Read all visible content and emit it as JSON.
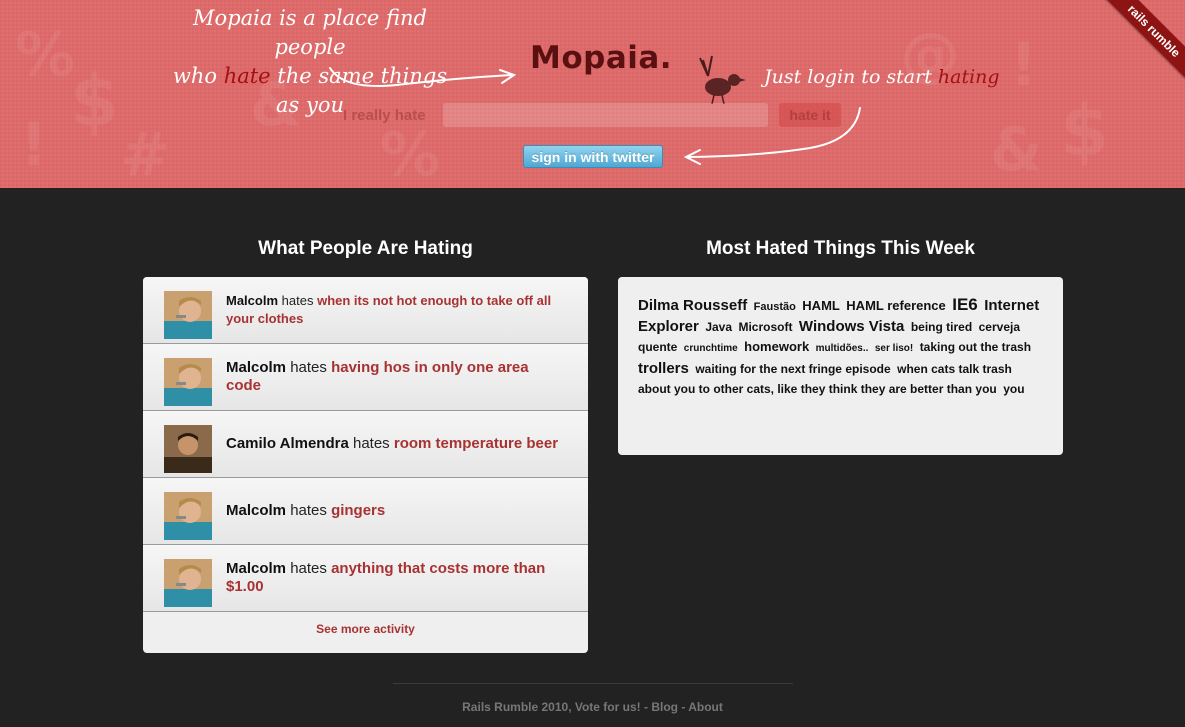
{
  "header": {
    "tagline_line1": "Mopaia is a place find people",
    "tagline_pre": "who ",
    "tagline_highlight": "hate",
    "tagline_post": " the same things as you",
    "logo": "Mopaia.",
    "login_hint_pre": "Just login to start ",
    "login_hint_highlight": "hating",
    "hate_label": "I really hate",
    "hate_input_value": "",
    "hate_button": "hate it",
    "signin_button": "sign in with twitter",
    "ribbon": "rails rumble"
  },
  "activity": {
    "title": "What People Are Hating",
    "verb": "hates",
    "items": [
      {
        "user": "Malcolm",
        "thing": "when its not hot enough to take off all your clothes"
      },
      {
        "user": "Malcolm",
        "thing": "having hos in only one area code"
      },
      {
        "user": "Camilo Almendra",
        "thing": "room temperature beer"
      },
      {
        "user": "Malcolm",
        "thing": "gingers"
      },
      {
        "user": "Malcolm",
        "thing": "anything that costs more than $1.00"
      }
    ],
    "see_more": "See more activity"
  },
  "cloud": {
    "title": "Most Hated Things This Week",
    "tags": [
      {
        "text": "Dilma Rousseff",
        "size": 15
      },
      {
        "text": "Faustão",
        "size": 11
      },
      {
        "text": "HAML",
        "size": 13
      },
      {
        "text": "HAML reference",
        "size": 13
      },
      {
        "text": "IE6",
        "size": 17
      },
      {
        "text": "Internet Explorer",
        "size": 15
      },
      {
        "text": "Java",
        "size": 12
      },
      {
        "text": "Microsoft",
        "size": 12
      },
      {
        "text": "Windows Vista",
        "size": 15
      },
      {
        "text": "being tired",
        "size": 12
      },
      {
        "text": "cerveja quente",
        "size": 12
      },
      {
        "text": "crunchtime",
        "size": 10
      },
      {
        "text": "homework",
        "size": 13
      },
      {
        "text": "multidões..",
        "size": 10
      },
      {
        "text": "ser liso!",
        "size": 10
      },
      {
        "text": "taking out the trash",
        "size": 12
      },
      {
        "text": "trollers",
        "size": 15
      },
      {
        "text": "waiting for the next fringe episode",
        "size": 12
      },
      {
        "text": "when cats talk trash about you to other cats, like they think they are better than you",
        "size": 12
      },
      {
        "text": "you",
        "size": 12
      }
    ]
  },
  "footer": {
    "rumble": "Rails Rumble 2010, Vote for us!",
    "sep1": " - ",
    "blog": "Blog",
    "sep2": " - ",
    "about": "About"
  },
  "colors": {
    "header_bg": "#e06a6a",
    "accent": "#a83232",
    "page_bg": "#222222",
    "twitter_button": "#5bb5de"
  }
}
